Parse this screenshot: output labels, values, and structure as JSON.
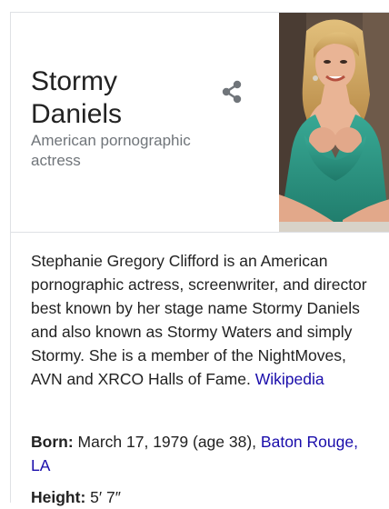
{
  "header": {
    "title_line1": "Stormy",
    "title_line2": "Daniels",
    "subtitle_line1": "American pornographic",
    "subtitle_line2": "actress"
  },
  "share": {
    "icon": "share-icon"
  },
  "photo": {
    "icon": "person-photo"
  },
  "description": {
    "text": "Stephanie Gregory Clifford is an American pornographic actress, screenwriter, and director best known by her stage name Stormy Daniels and also known as Stormy Waters and simply Stormy. She is a member of the NightMoves, AVN and XRCO Halls of Fame.",
    "source_link": "Wikipedia"
  },
  "facts": {
    "born": {
      "label": "Born:",
      "value": "March 17, 1979 (age 38),",
      "link": "Baton Rouge, LA"
    },
    "height": {
      "label": "Height:",
      "value": "5′ 7″"
    }
  },
  "colors": {
    "link": "#1a0dab",
    "subtitle": "#70757a",
    "text": "#222222",
    "divider": "#dfe1e5",
    "photo_dress": "#2f9a88"
  }
}
